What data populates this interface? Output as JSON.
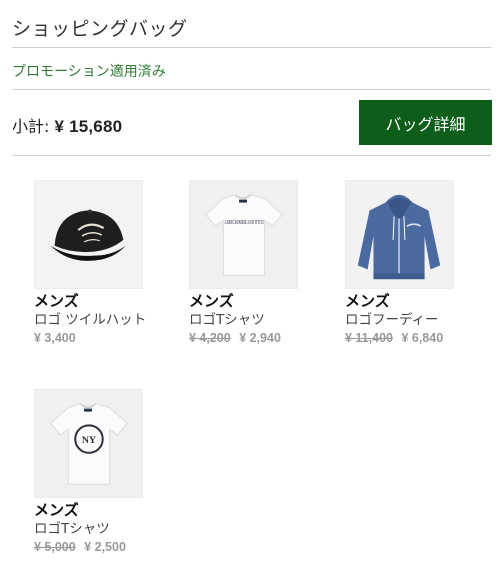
{
  "header": {
    "title": "ショッピングバッグ"
  },
  "promo": {
    "label": "プロモーション適用済み"
  },
  "subtotal": {
    "label": "小計:",
    "amount": "¥ 15,680"
  },
  "actions": {
    "bag_detail_label": "バッグ詳細"
  },
  "items": [
    {
      "category": "メンズ",
      "name": "ロゴ ツイルハット",
      "original_price": "",
      "price": "¥ 3,400",
      "icon": "cap-image"
    },
    {
      "category": "メンズ",
      "name": "ロゴTシャツ",
      "original_price": "¥ 4,200",
      "price": "¥ 2,940",
      "icon": "tshirt-image",
      "print": "ABERCROMBIE AND FITCH"
    },
    {
      "category": "メンズ",
      "name": "ロゴフーディー",
      "original_price": "¥ 11,400",
      "price": "¥ 6,840",
      "icon": "hoodie-image"
    },
    {
      "category": "メンズ",
      "name": "ロゴTシャツ",
      "original_price": "¥ 5,000",
      "price": "¥ 2,500",
      "icon": "tshirt-image",
      "print": "NY"
    }
  ],
  "colors": {
    "accent": "#0d5e1a",
    "promo": "#2e7d32",
    "hoodie": "#4a6aa0",
    "cap": "#1e1e1e"
  }
}
